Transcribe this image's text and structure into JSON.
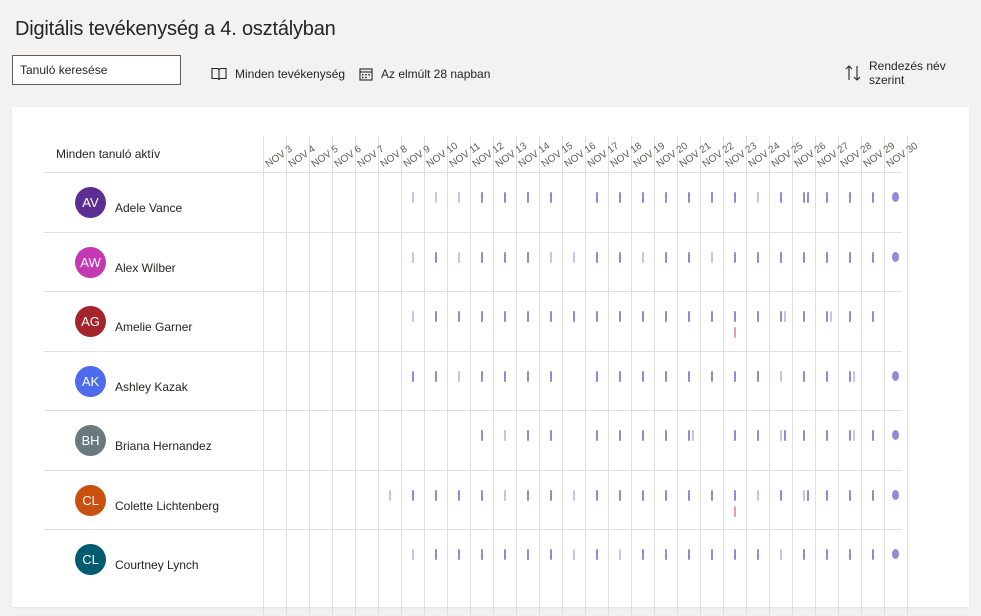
{
  "page": {
    "title": "Digitális tevékenység a 4. osztályban"
  },
  "toolbar": {
    "search_placeholder": "Tanuló keresése",
    "activity_filter": "Minden tevékenység",
    "activity_icon": "book-icon",
    "period_filter": "Az elmúlt 28 napban",
    "period_icon": "calendar-icon",
    "sort": "Rendezés név szerint",
    "sort_icon": "sort-arrows-icon"
  },
  "grid": {
    "header": "Minden tanuló aktív",
    "dates": [
      "NOV 3",
      "NOV 4",
      "NOV 5",
      "NOV 6",
      "NOV 7",
      "NOV 8",
      "NOV 9",
      "NOV 10",
      "NOV 11",
      "NOV 12",
      "NOV 13",
      "NOV 14",
      "NOV 15",
      "NOV 16",
      "NOV 17",
      "NOV 18",
      "NOV 19",
      "NOV 20",
      "NOV 21",
      "NOV 22",
      "NOV 23",
      "NOV 24",
      "NOV 25",
      "NOV 26",
      "NOV 27",
      "NOV 28",
      "NOV 29",
      "NOV 30"
    ],
    "colors": {
      "activity": "#8e8cd8",
      "activity_light": "#c5c4ef",
      "alert": "#e8a0a0"
    }
  },
  "students": [
    {
      "initials": "AV",
      "name": "Adele Vance",
      "color": "#5c2e91",
      "marks": [
        [
          9,
          "light"
        ],
        [
          10,
          "light"
        ],
        [
          11,
          "light"
        ],
        [
          12
        ],
        [
          13
        ],
        [
          14
        ],
        [
          15
        ],
        [
          17
        ],
        [
          18
        ],
        [
          19
        ],
        [
          20
        ],
        [
          21
        ],
        [
          22
        ],
        [
          23
        ],
        [
          24,
          "light"
        ],
        [
          25
        ],
        [
          26
        ],
        [
          26
        ],
        [
          27
        ],
        [
          28
        ],
        [
          29
        ],
        [
          30,
          "dot"
        ]
      ]
    },
    {
      "initials": "AW",
      "name": "Alex Wilber",
      "color": "#c239b3",
      "marks": [
        [
          9,
          "light"
        ],
        [
          10
        ],
        [
          11,
          "light"
        ],
        [
          12
        ],
        [
          13
        ],
        [
          14
        ],
        [
          15,
          "light"
        ],
        [
          16,
          "light"
        ],
        [
          17
        ],
        [
          18
        ],
        [
          19,
          "light"
        ],
        [
          20
        ],
        [
          21
        ],
        [
          22,
          "light"
        ],
        [
          23
        ],
        [
          24
        ],
        [
          25
        ],
        [
          26
        ],
        [
          27
        ],
        [
          28
        ],
        [
          29
        ],
        [
          30,
          "dot"
        ]
      ]
    },
    {
      "initials": "AG",
      "name": "Amelie Garner",
      "color": "#a4262c",
      "marks": [
        [
          9,
          "light"
        ],
        [
          10
        ],
        [
          11
        ],
        [
          12
        ],
        [
          13
        ],
        [
          14
        ],
        [
          15
        ],
        [
          16
        ],
        [
          17
        ],
        [
          18
        ],
        [
          19
        ],
        [
          20
        ],
        [
          21
        ],
        [
          22
        ],
        [
          23
        ],
        [
          23,
          "red"
        ],
        [
          24
        ],
        [
          25
        ],
        [
          25,
          "light"
        ],
        [
          26
        ],
        [
          27
        ],
        [
          27,
          "light"
        ],
        [
          28
        ],
        [
          29
        ]
      ]
    },
    {
      "initials": "AK",
      "name": "Ashley Kazak",
      "color": "#4f6bed",
      "marks": [
        [
          9
        ],
        [
          10
        ],
        [
          11,
          "light"
        ],
        [
          12
        ],
        [
          13
        ],
        [
          14
        ],
        [
          15
        ],
        [
          17
        ],
        [
          18
        ],
        [
          19
        ],
        [
          20
        ],
        [
          21
        ],
        [
          22
        ],
        [
          23
        ],
        [
          24
        ],
        [
          25,
          "light"
        ],
        [
          26
        ],
        [
          27
        ],
        [
          28
        ],
        [
          28,
          "light"
        ],
        [
          30,
          "dot"
        ]
      ]
    },
    {
      "initials": "BH",
      "name": "Briana Hernandez",
      "color": "#69797e",
      "marks": [
        [
          12
        ],
        [
          13,
          "light"
        ],
        [
          14
        ],
        [
          15
        ],
        [
          17
        ],
        [
          18
        ],
        [
          19
        ],
        [
          20
        ],
        [
          21
        ],
        [
          21,
          "light"
        ],
        [
          23
        ],
        [
          24
        ],
        [
          25,
          "light"
        ],
        [
          25
        ],
        [
          26
        ],
        [
          27
        ],
        [
          28
        ],
        [
          28,
          "light"
        ],
        [
          29
        ],
        [
          30,
          "dot"
        ]
      ]
    },
    {
      "initials": "CL",
      "name": "Colette Lichtenberg",
      "color": "#ca5010",
      "marks": [
        [
          8,
          "light"
        ],
        [
          9
        ],
        [
          10
        ],
        [
          11
        ],
        [
          12
        ],
        [
          13,
          "light"
        ],
        [
          14
        ],
        [
          15
        ],
        [
          16,
          "light"
        ],
        [
          17
        ],
        [
          18
        ],
        [
          19
        ],
        [
          20
        ],
        [
          21
        ],
        [
          22
        ],
        [
          23
        ],
        [
          23,
          "red"
        ],
        [
          24,
          "light"
        ],
        [
          25
        ],
        [
          26,
          "light"
        ],
        [
          26
        ],
        [
          27
        ],
        [
          28
        ],
        [
          29
        ],
        [
          30,
          "dot"
        ]
      ]
    },
    {
      "initials": "CL",
      "name": "Courtney Lynch",
      "color": "#005b70",
      "marks": [
        [
          9,
          "light"
        ],
        [
          10
        ],
        [
          11
        ],
        [
          12
        ],
        [
          13
        ],
        [
          14
        ],
        [
          15
        ],
        [
          16,
          "light"
        ],
        [
          17
        ],
        [
          18,
          "light"
        ],
        [
          19
        ],
        [
          20
        ],
        [
          21
        ],
        [
          22
        ],
        [
          23
        ],
        [
          24
        ],
        [
          25,
          "light"
        ],
        [
          26
        ],
        [
          27
        ],
        [
          28
        ],
        [
          29
        ],
        [
          30,
          "dot"
        ]
      ]
    }
  ]
}
